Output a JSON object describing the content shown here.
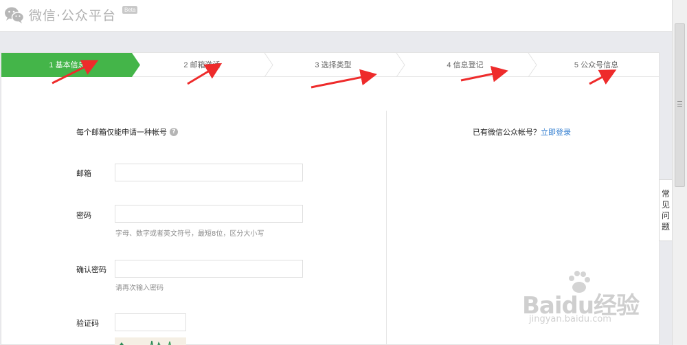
{
  "header": {
    "title": "微信·公众平台",
    "beta": "Beta"
  },
  "steps": [
    {
      "label": "1 基本信息"
    },
    {
      "label": "2 邮箱激活"
    },
    {
      "label": "3 选择类型"
    },
    {
      "label": "4 信息登记"
    },
    {
      "label": "5 公众号信息"
    }
  ],
  "form": {
    "notice": "每个邮箱仅能申请一种帐号",
    "help_glyph": "?",
    "email_label": "邮箱",
    "password_label": "密码",
    "password_hint": "字母、数字或者英文符号，最短8位，区分大小写",
    "confirm_label": "确认密码",
    "confirm_hint": "请再次输入密码",
    "captcha_label": "验证码"
  },
  "login": {
    "prompt": "已有微信公众帐号？",
    "link": "立即登录"
  },
  "faq": {
    "chars": [
      "常",
      "见",
      "问",
      "题"
    ]
  },
  "watermark": {
    "text": "Baidu经验",
    "url": "jingyan.baidu.com"
  },
  "colors": {
    "active_step": "#44b549",
    "arrow": "#ee2b2b",
    "link": "#2e7bcf"
  }
}
